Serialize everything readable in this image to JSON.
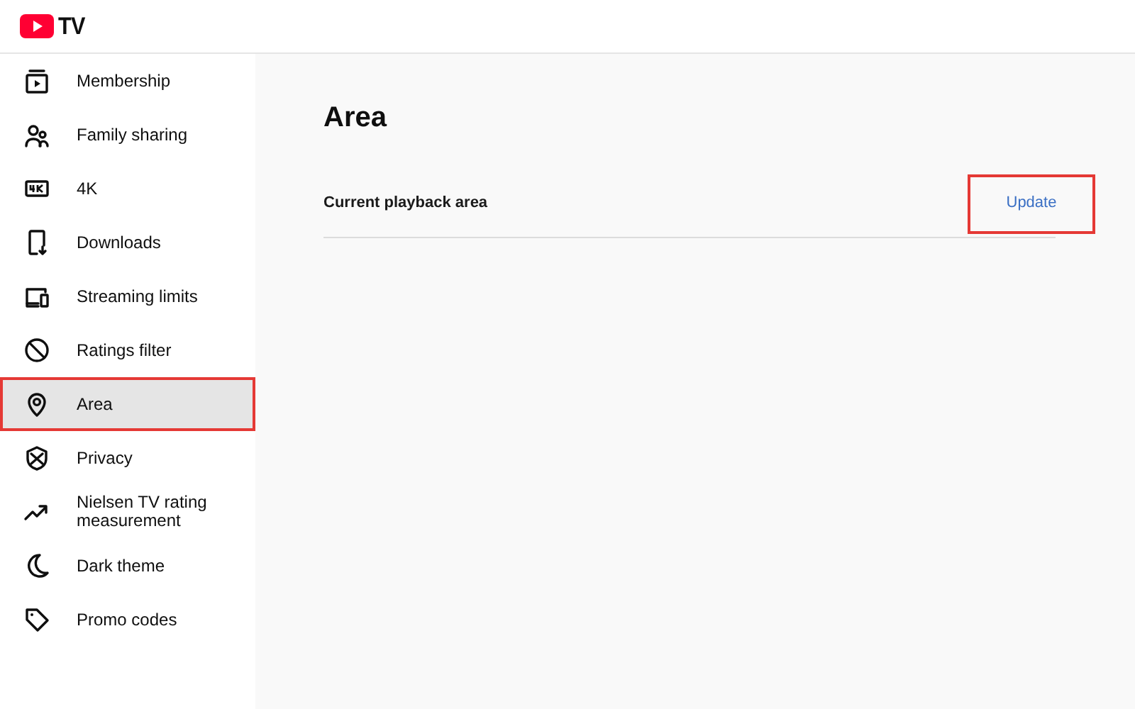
{
  "header": {
    "logo_text": "TV"
  },
  "sidebar": {
    "items": [
      {
        "label": "Membership",
        "selected": false,
        "highlighted": false
      },
      {
        "label": "Family sharing",
        "selected": false,
        "highlighted": false
      },
      {
        "label": "4K",
        "selected": false,
        "highlighted": false
      },
      {
        "label": "Downloads",
        "selected": false,
        "highlighted": false
      },
      {
        "label": "Streaming limits",
        "selected": false,
        "highlighted": false
      },
      {
        "label": "Ratings filter",
        "selected": false,
        "highlighted": false
      },
      {
        "label": "Area",
        "selected": true,
        "highlighted": true
      },
      {
        "label": "Privacy",
        "selected": false,
        "highlighted": false
      },
      {
        "label": "Nielsen TV rating measurement",
        "selected": false,
        "highlighted": false
      },
      {
        "label": "Dark theme",
        "selected": false,
        "highlighted": false
      },
      {
        "label": "Promo codes",
        "selected": false,
        "highlighted": false
      }
    ]
  },
  "main": {
    "title": "Area",
    "rows": [
      {
        "label": "Current playback area",
        "action": "Update",
        "highlighted": true
      }
    ]
  }
}
